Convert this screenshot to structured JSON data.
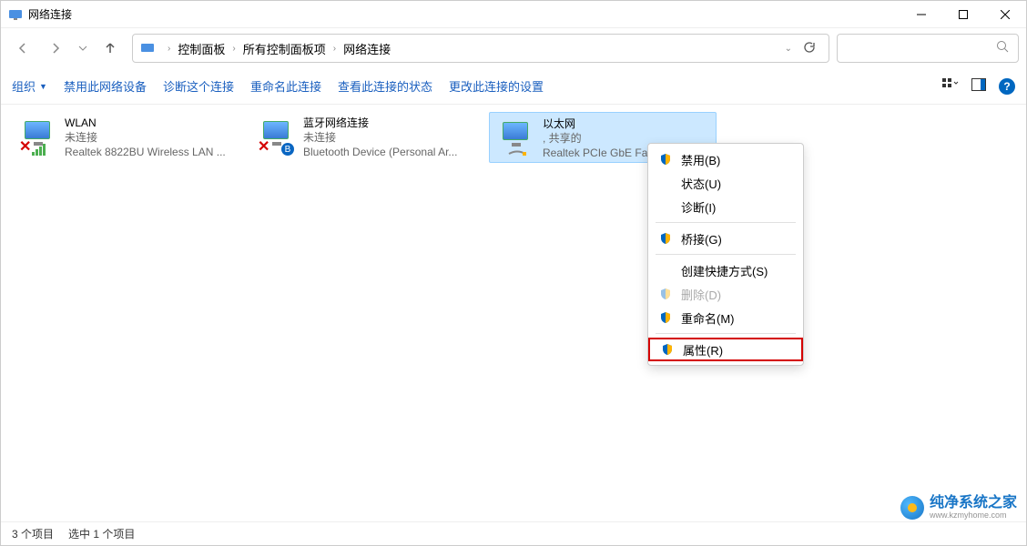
{
  "window": {
    "title": "网络连接"
  },
  "breadcrumb": {
    "root": "控制面板",
    "mid": "所有控制面板项",
    "leaf": "网络连接"
  },
  "toolbar": {
    "organize": "组织",
    "disable": "禁用此网络设备",
    "diagnose": "诊断这个连接",
    "rename": "重命名此连接",
    "status": "查看此连接的状态",
    "settings": "更改此连接的设置"
  },
  "connections": {
    "wlan": {
      "name": "WLAN",
      "status": "未连接",
      "device": "Realtek 8822BU Wireless LAN ..."
    },
    "bt": {
      "name": "蓝牙网络连接",
      "status": "未连接",
      "device": "Bluetooth Device (Personal Ar..."
    },
    "eth": {
      "name": "以太网",
      "status": ", 共享的",
      "device": "Realtek PCIe GbE Famil..."
    }
  },
  "context_menu": {
    "disable": "禁用(B)",
    "status": "状态(U)",
    "diagnose": "诊断(I)",
    "bridge": "桥接(G)",
    "shortcut": "创建快捷方式(S)",
    "delete": "删除(D)",
    "rename": "重命名(M)",
    "properties": "属性(R)"
  },
  "statusbar": {
    "items": "3 个项目",
    "selected": "选中 1 个项目"
  },
  "watermark": {
    "brand": "纯净系统之家",
    "url": "www.kzmyhome.com"
  }
}
